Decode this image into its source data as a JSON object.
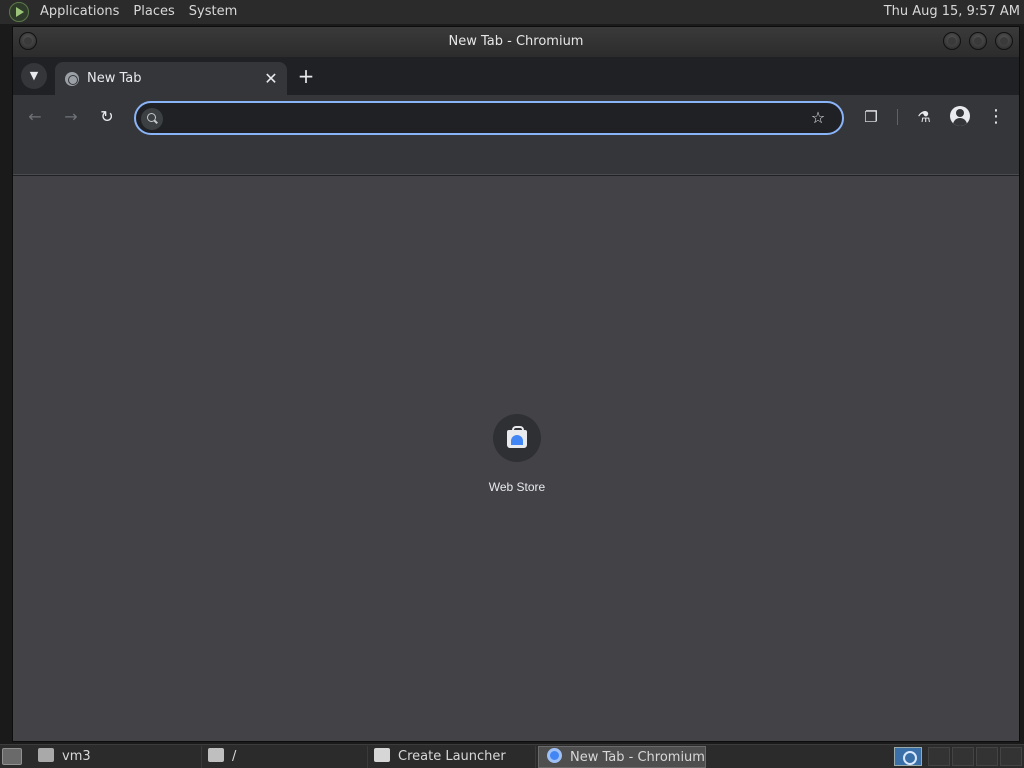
{
  "top_panel": {
    "menus": [
      "Applications",
      "Places",
      "System"
    ],
    "clock": "Thu Aug 15,  9:57 AM"
  },
  "window": {
    "title": "New Tab - Chromium"
  },
  "browser": {
    "tab": {
      "title": "New Tab"
    },
    "omnibox": {
      "value": "",
      "placeholder": ""
    },
    "shortcuts": [
      {
        "label": "Web Store",
        "icon": "web-store-icon"
      }
    ]
  },
  "taskbar": {
    "tasks": [
      {
        "label": "vm3",
        "icon": "home-folder-icon"
      },
      {
        "label": "/",
        "icon": "folder-icon"
      },
      {
        "label": "Create Launcher",
        "icon": "launcher-icon"
      },
      {
        "label": "New Tab - Chromium",
        "icon": "chromium-icon",
        "active": true
      }
    ]
  },
  "colors": {
    "accent_focus": "#8ab4f8",
    "content_bg": "#434347",
    "toolbar_bg": "#35363a"
  }
}
